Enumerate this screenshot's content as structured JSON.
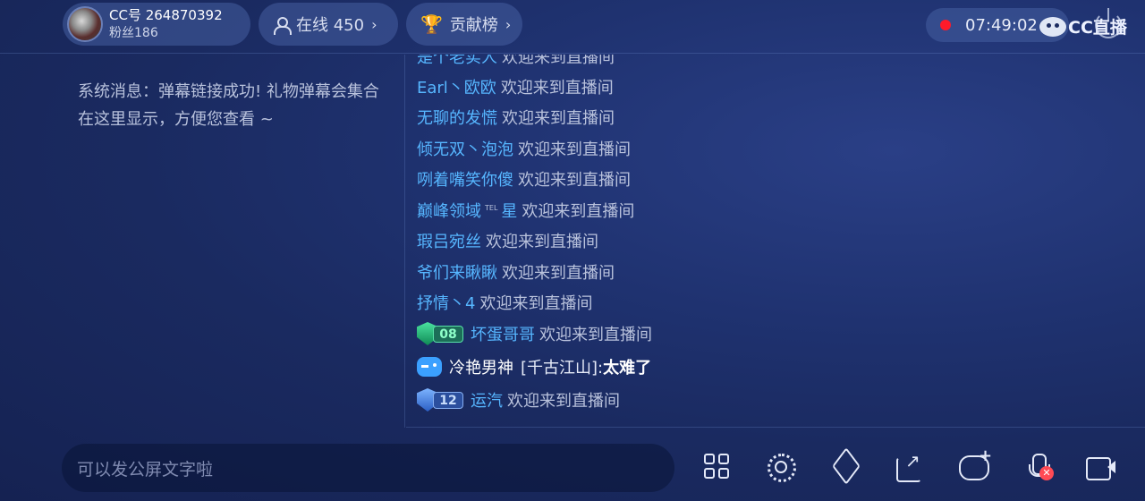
{
  "header": {
    "cc_id": "CC号 264870392",
    "fans": "粉丝186",
    "online_label": "在线 450",
    "rank_label": "贡献榜",
    "timer": "07:49:02",
    "brand": "CC直播"
  },
  "system_message": "系统消息：弹幕链接成功! 礼物弹幕会集合在这里显示，方便您查看 ~",
  "welcome_text": "欢迎来到直播间",
  "chat": [
    {
      "name": "是个老实人"
    },
    {
      "name": "Earl丶欧欧"
    },
    {
      "name": "无聊的发慌"
    },
    {
      "name": "倾无双丶泡泡"
    },
    {
      "name": "咧着嘴笑你傻"
    },
    {
      "name_a": "巅峰领域",
      "sup": "TEL",
      "name_b": "星"
    },
    {
      "name": "瑕吕宛丝"
    },
    {
      "name": "爷们来瞅瞅"
    },
    {
      "name": "抒情丶4"
    },
    {
      "badge_level": "08",
      "name": "坏蛋哥哥"
    },
    {
      "name": "冷艳男神",
      "tag": "[千古江山]:",
      "message": "太难了"
    },
    {
      "badge_level": "12",
      "name": "运汽"
    }
  ],
  "input": {
    "placeholder": "可以发公屏文字啦"
  },
  "colors": {
    "username": "#56b6ff",
    "recording": "#ff1a2a"
  }
}
